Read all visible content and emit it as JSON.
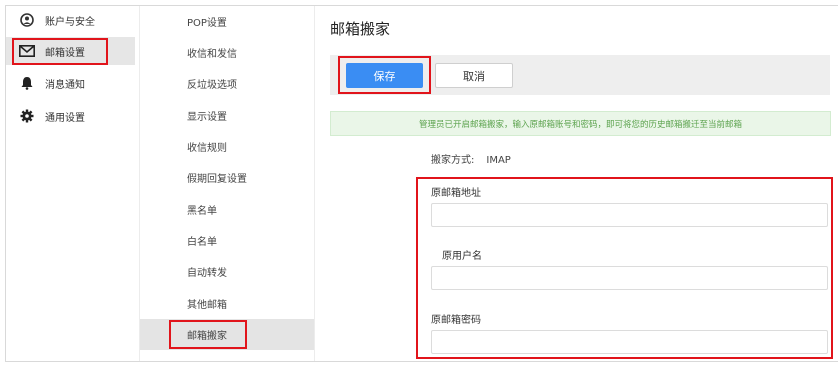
{
  "nav": {
    "items": [
      {
        "label": "账户与安全",
        "icon": "account-circle-icon"
      },
      {
        "label": "邮箱设置",
        "icon": "mail-icon"
      },
      {
        "label": "消息通知",
        "icon": "bell-icon"
      },
      {
        "label": "通用设置",
        "icon": "gear-icon"
      }
    ]
  },
  "submenu": {
    "items": [
      {
        "label": "POP设置"
      },
      {
        "label": "收信和发信"
      },
      {
        "label": "反垃圾选项"
      },
      {
        "label": "显示设置"
      },
      {
        "label": "收信规则"
      },
      {
        "label": "假期回复设置"
      },
      {
        "label": "黑名单"
      },
      {
        "label": "白名单"
      },
      {
        "label": "自动转发"
      },
      {
        "label": "其他邮箱"
      },
      {
        "label": "邮箱搬家"
      }
    ]
  },
  "main": {
    "title": "邮箱搬家",
    "save_label": "保存",
    "cancel_label": "取消",
    "notice": "管理员已开启邮箱搬家，输入原邮箱账号和密码，即可将您的历史邮箱搬迁至当前邮箱",
    "method_label": "搬家方式:",
    "method_value": "IMAP",
    "fields": [
      {
        "label": "原邮箱地址",
        "value": ""
      },
      {
        "label": "原用户名",
        "value": ""
      },
      {
        "label": "原邮箱密码",
        "value": ""
      }
    ]
  },
  "colors": {
    "accent": "#3a8df3",
    "highlight": "#e1141b",
    "notice_bg": "#eaf6e8",
    "notice_text": "#5ca34e"
  }
}
